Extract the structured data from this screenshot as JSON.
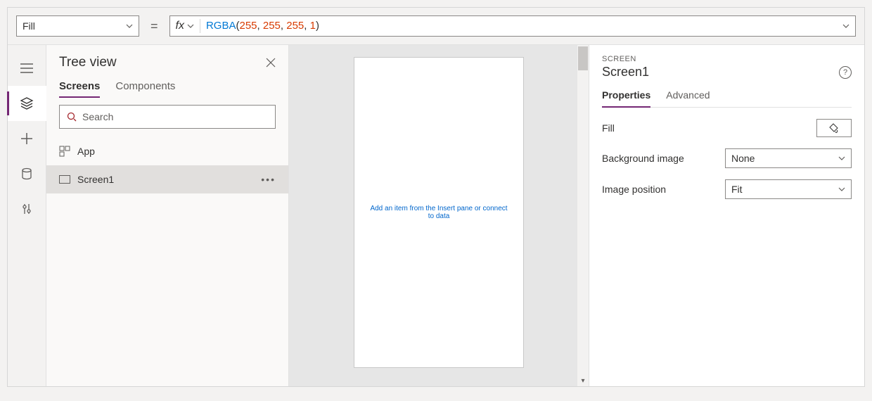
{
  "formula_bar": {
    "property": "Fill",
    "fx_label": "fx",
    "formula_fn": "RGBA",
    "formula_args": [
      "255",
      "255",
      "255",
      "1"
    ]
  },
  "tree_view": {
    "title": "Tree view",
    "tabs": {
      "screens": "Screens",
      "components": "Components"
    },
    "search_placeholder": "Search",
    "items": {
      "app": "App",
      "screen1": "Screen1"
    }
  },
  "canvas": {
    "hint": "Add an item from the Insert pane or connect to data"
  },
  "properties": {
    "category": "SCREEN",
    "name": "Screen1",
    "tabs": {
      "properties": "Properties",
      "advanced": "Advanced"
    },
    "rows": {
      "fill_label": "Fill",
      "bg_image_label": "Background image",
      "bg_image_value": "None",
      "img_pos_label": "Image position",
      "img_pos_value": "Fit"
    }
  }
}
